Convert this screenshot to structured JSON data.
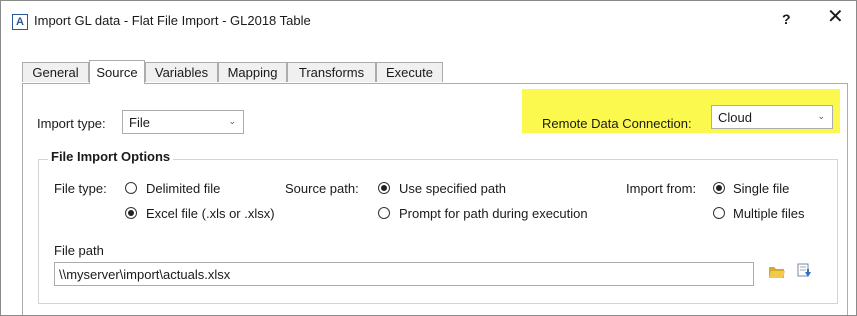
{
  "window": {
    "title": "Import GL data - Flat File Import - GL2018 Table",
    "help_label": "?",
    "close_label": "✕",
    "app_icon": "A"
  },
  "tabs": [
    {
      "label": "General"
    },
    {
      "label": "Source"
    },
    {
      "label": "Variables"
    },
    {
      "label": "Mapping"
    },
    {
      "label": "Transforms"
    },
    {
      "label": "Execute"
    }
  ],
  "active_tab": "Source",
  "import_type": {
    "label": "Import type:",
    "value": "File"
  },
  "remote": {
    "label": "Remote Data Connection:",
    "value": "Cloud",
    "highlight_color": "#fbf94e"
  },
  "options": {
    "title": "File Import Options",
    "file_type": {
      "label": "File type:",
      "choices": [
        {
          "label": "Delimited file",
          "selected": false
        },
        {
          "label": "Excel file (.xls or .xlsx)",
          "selected": true
        }
      ]
    },
    "source_path": {
      "label": "Source path:",
      "choices": [
        {
          "label": "Use specified path",
          "selected": true
        },
        {
          "label": "Prompt for path during execution",
          "selected": false
        }
      ]
    },
    "import_from": {
      "label": "Import from:",
      "choices": [
        {
          "label": "Single file",
          "selected": true
        },
        {
          "label": "Multiple files",
          "selected": false
        }
      ]
    },
    "file_path": {
      "label": "File path",
      "value": "\\\\myserver\\import\\actuals.xlsx"
    }
  },
  "icons": {
    "browse": "folder-icon",
    "download": "download-icon",
    "dropdown": "chevron-down-icon"
  }
}
